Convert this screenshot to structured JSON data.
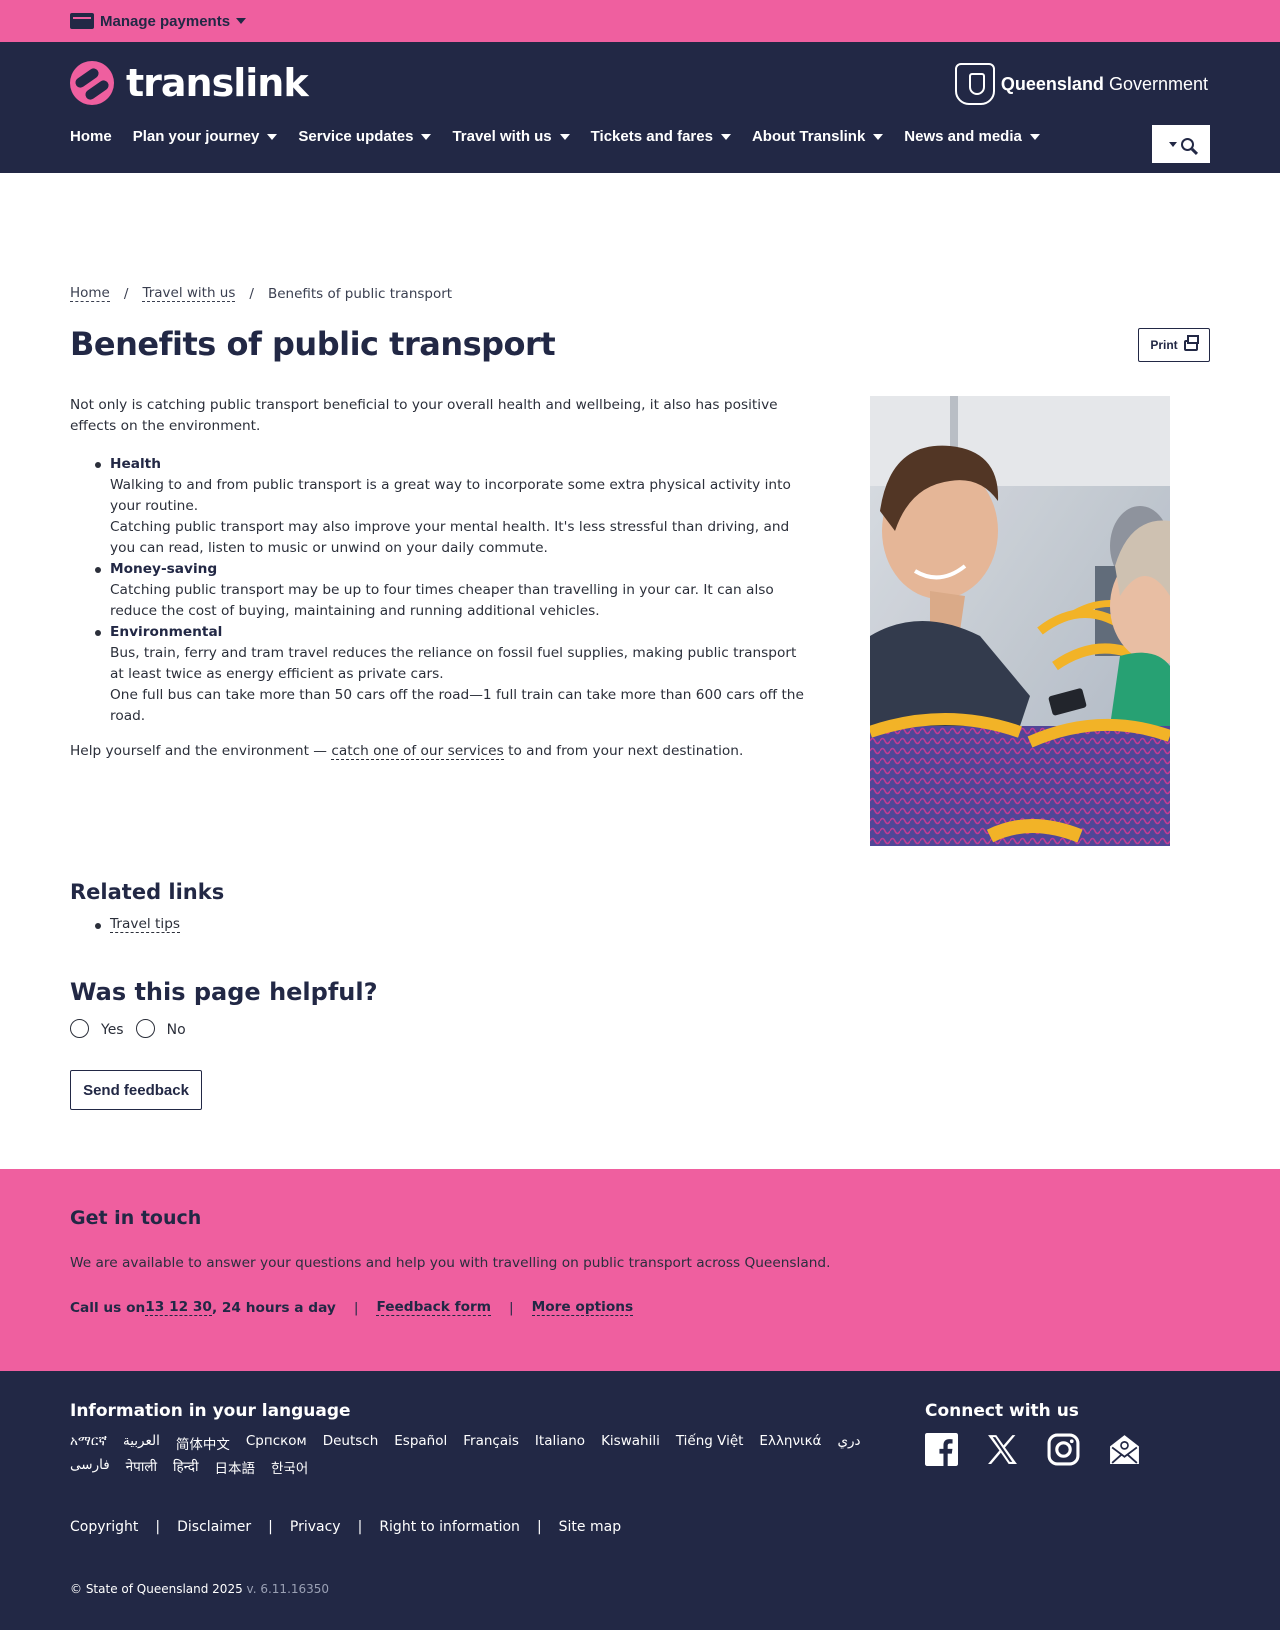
{
  "topbar": {
    "manage_label": "Manage payments"
  },
  "header": {
    "brand_name": "translink",
    "gov_bold": "Queensland",
    "gov_light": "Government",
    "nav": [
      "Home",
      "Plan your journey",
      "Service updates",
      "Travel with us",
      "Tickets and fares",
      "About Translink",
      "News and media"
    ]
  },
  "breadcrumb": {
    "home": "Home",
    "sep": "/",
    "parent": "Travel with us",
    "current": "Benefits of public transport"
  },
  "page": {
    "title": "Benefits of public transport",
    "print_label": "Print",
    "intro": "Not only is catching public transport beneficial to your overall health and wellbeing, it also has positive effects on the environment.",
    "benefits": [
      {
        "heading": "Health",
        "lines": [
          "Walking to and from public transport is a great way to incorporate some extra physical activity into your routine.",
          "Catching public transport may also improve your mental health. It's less stressful than driving, and you can read, listen to music or unwind on your daily commute."
        ]
      },
      {
        "heading": "Money-saving",
        "lines": [
          "Catching public transport may be up to four times cheaper than travelling in your car. It can also reduce the cost of buying, maintaining and running additional vehicles."
        ]
      },
      {
        "heading": "Environmental",
        "lines": [
          "Bus, train, ferry and tram travel reduces the reliance on fossil fuel supplies, making public transport at least twice as energy efficient as private cars.",
          "One full bus can take more than 50 cars off the road—1 full train can take more than 600 cars off the road."
        ]
      }
    ],
    "closing_pre": "Help yourself and the environment — ",
    "closing_link": "catch one of our services",
    "closing_post": " to and from your next destination."
  },
  "related": {
    "heading": "Related links",
    "links": [
      "Travel tips"
    ]
  },
  "feedback": {
    "heading": "Was this page helpful?",
    "yes": "Yes",
    "no": "No",
    "button": "Send feedback"
  },
  "touch": {
    "heading": "Get in touch",
    "text": "We are available to answer your questions and help you with travelling on public transport across Queensland.",
    "call_pre": "Call us on ",
    "phone": "13 12 30",
    "call_post": ", 24 hours a day",
    "sep": "|",
    "feedback_form": "Feedback form",
    "more_options": "More options"
  },
  "footer": {
    "lang_heading": "Information in your language",
    "languages": [
      "አማርኛ",
      "العربية",
      "简体中文",
      "Српском",
      "Deutsch",
      "Español",
      "Français",
      "Italiano",
      "Kiswahili",
      "Tiếng Việt",
      "Ελληνικά",
      "دري",
      "فارسی",
      "नेपाली",
      "हिन्दी",
      "日本語",
      "한국어"
    ],
    "connect_heading": "Connect with us",
    "social_icons": [
      "facebook-icon",
      "x-icon",
      "instagram-icon",
      "email-icon"
    ],
    "legal": [
      "Copyright",
      "Disclaimer",
      "Privacy",
      "Right to information",
      "Site map"
    ],
    "legal_sep": "|",
    "copyright": "© State of Queensland 2025",
    "version": "v. 6.11.16350"
  },
  "colors": {
    "pink": "#ef5f9f",
    "navy": "#222845"
  }
}
